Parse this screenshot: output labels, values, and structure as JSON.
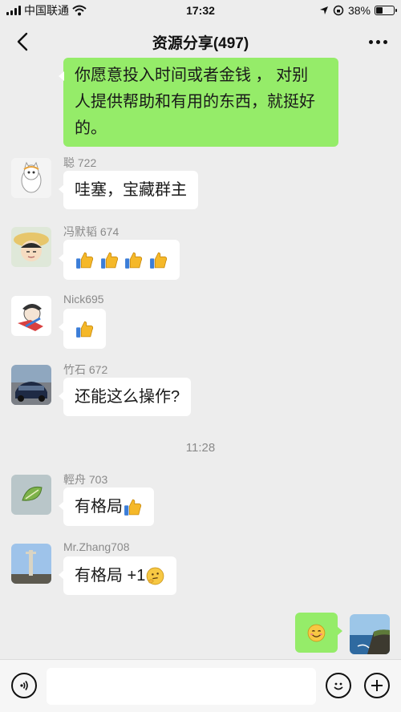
{
  "status_bar": {
    "carrier": "中国联通",
    "time": "17:32",
    "battery": "38%",
    "battery_level": 0.38
  },
  "nav": {
    "title": "资源分享(497)",
    "back_icon": "chevron-left-icon",
    "more_icon": "more-dots-icon"
  },
  "messages": [
    {
      "type": "self-top",
      "text_lines": [
        "你愿意投入时间或者金钱 ， 对别",
        "人提供帮助和有用的东西，就挺好",
        "的。"
      ]
    },
    {
      "sender": "聪 722",
      "text": "哇塞，宝藏群主"
    },
    {
      "sender": "冯默韬 674",
      "text": ""
    },
    {
      "sender": "Nick695",
      "text": ""
    },
    {
      "sender": "竹石 672",
      "text": "还能这么操作?"
    },
    {
      "sender": "輕舟 703",
      "text": "有格局"
    },
    {
      "sender": "Mr.Zhang708",
      "text": "有格局 +1"
    }
  ],
  "time_separator": "11:28",
  "input": {
    "placeholder": "",
    "voice_icon": "voice-icon",
    "emoji_icon": "emoji-icon",
    "plus_icon": "plus-icon"
  },
  "colors": {
    "background": "#ededed",
    "bubble_self": "#95ec69",
    "bubble_other": "#ffffff"
  }
}
